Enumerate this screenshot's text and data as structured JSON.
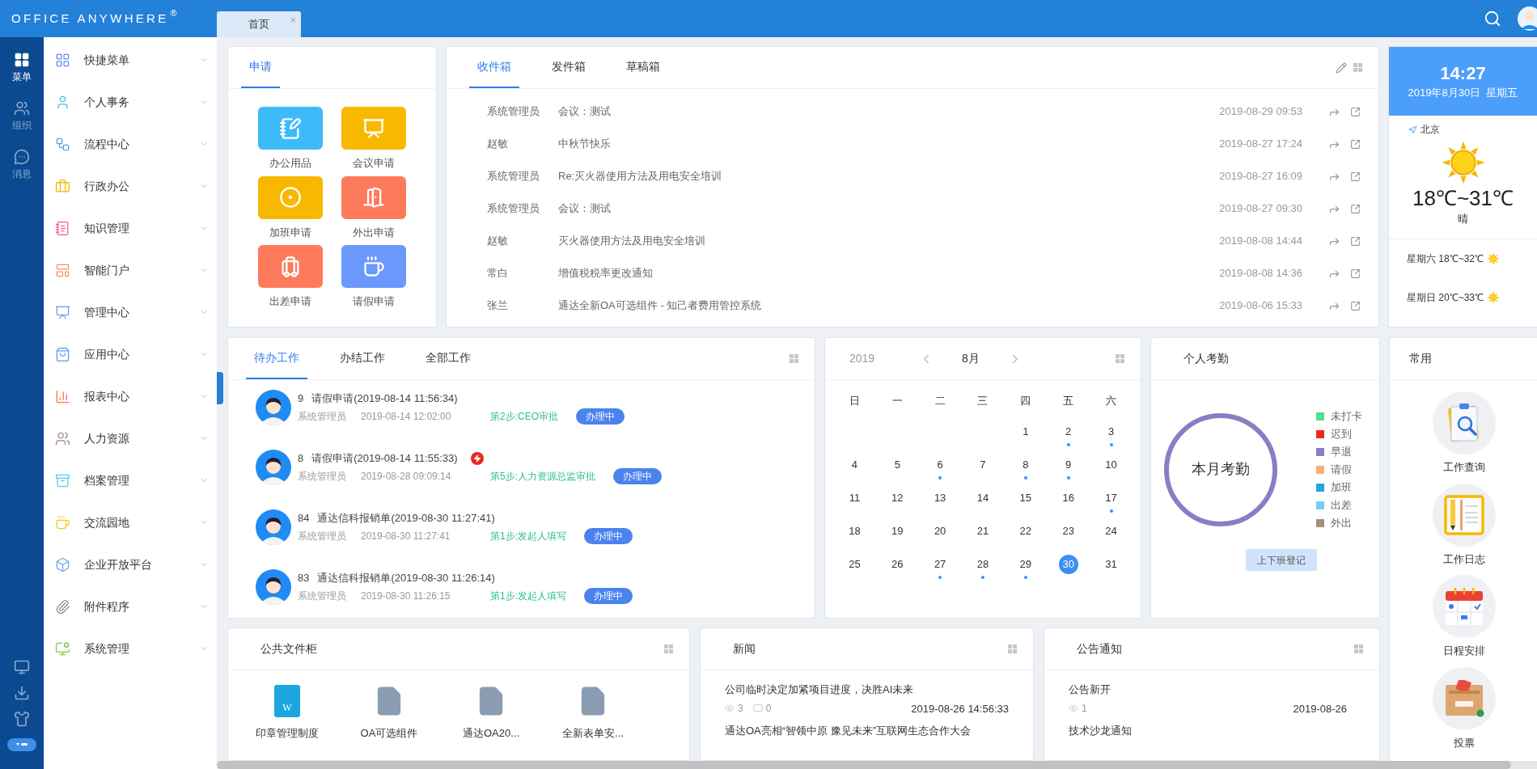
{
  "header": {
    "logo": "OFFICE ANYWHERE",
    "logo_mark": "®",
    "tabs": [
      {
        "label": "首页",
        "close": "×",
        "selected": true
      }
    ]
  },
  "rail": {
    "items": [
      {
        "label": "菜单",
        "selected": true
      },
      {
        "label": "组织",
        "selected": false
      },
      {
        "label": "消息",
        "selected": false
      }
    ]
  },
  "sidebar": {
    "items": [
      {
        "label": "快捷菜单"
      },
      {
        "label": "个人事务"
      },
      {
        "label": "流程中心"
      },
      {
        "label": "行政办公"
      },
      {
        "label": "知识管理"
      },
      {
        "label": "智能门户"
      },
      {
        "label": "管理中心"
      },
      {
        "label": "应用中心"
      },
      {
        "label": "报表中心"
      },
      {
        "label": "人力资源"
      },
      {
        "label": "档案管理"
      },
      {
        "label": "交流园地"
      },
      {
        "label": "企业开放平台"
      },
      {
        "label": "附件程序"
      },
      {
        "label": "系统管理"
      }
    ]
  },
  "apply": {
    "tabs": [
      {
        "label": "申请",
        "selected": true
      }
    ],
    "items": [
      {
        "label": "办公用品",
        "color": "#3dbbf8"
      },
      {
        "label": "会议申请",
        "color": "#f8b800"
      },
      {
        "label": "加班申请",
        "color": "#f8b800"
      },
      {
        "label": "外出申请",
        "color": "#fd7b5b"
      },
      {
        "label": "出差申请",
        "color": "#fd7b5b"
      },
      {
        "label": "请假申请",
        "color": "#6b98fb"
      }
    ]
  },
  "mail": {
    "tabs": [
      {
        "label": "收件箱",
        "selected": true
      },
      {
        "label": "发件箱",
        "selected": false
      },
      {
        "label": "草稿箱",
        "selected": false
      }
    ],
    "rows": [
      {
        "sender": "系统管理员",
        "subject": "会议：测试",
        "time": "2019-08-29 09:53"
      },
      {
        "sender": "赵敏",
        "subject": "中秋节快乐",
        "time": "2019-08-27 17:24"
      },
      {
        "sender": "系统管理员",
        "subject": "Re:灭火器使用方法及用电安全培训",
        "time": "2019-08-27 16:09"
      },
      {
        "sender": "系统管理员",
        "subject": "会议：测试",
        "time": "2019-08-27 09:30"
      },
      {
        "sender": "赵敏",
        "subject": "灭火器使用方法及用电安全培训",
        "time": "2019-08-08 14:44"
      },
      {
        "sender": "常白",
        "subject": "增值税税率更改通知",
        "time": "2019-08-08 14:36"
      },
      {
        "sender": "张兰",
        "subject": "通达全新OA可选组件 - 知己者费用管控系统",
        "time": "2019-08-06 15:33"
      }
    ]
  },
  "weather": {
    "time": "14:27",
    "date": "2019年8月30日  星期五",
    "city": "北京",
    "temp": "18℃~31℃",
    "condition": "晴",
    "forecast": [
      {
        "text": "星期六 18℃~32℃"
      },
      {
        "text": "星期日 20℃~33℃"
      }
    ]
  },
  "work": {
    "tabs": [
      {
        "label": "待办工作",
        "selected": true
      },
      {
        "label": "办结工作",
        "selected": false
      },
      {
        "label": "全部工作",
        "selected": false
      }
    ],
    "items": [
      {
        "number": "9",
        "title": "请假申请(2019-08-14 11:56:34)",
        "user": "系统管理员",
        "time": "2019-08-14 12:02:00",
        "step": "第2步:CEO审批",
        "status": "办理中",
        "urgent": false
      },
      {
        "number": "8",
        "title": "请假申请(2019-08-14 11:55:33)",
        "user": "系统管理员",
        "time": "2019-08-28 09:09:14",
        "step": "第5步:人力资源总监审批",
        "status": "办理中",
        "urgent": true
      },
      {
        "number": "84",
        "title": "通达信科报销单(2019-08-30 11:27:41)",
        "user": "系统管理员",
        "time": "2019-08-30 11:27:41",
        "step": "第1步:发起人填写",
        "status": "办理中",
        "urgent": false
      },
      {
        "number": "83",
        "title": "通达信科报销单(2019-08-30 11:26:14)",
        "user": "系统管理员",
        "time": "2019-08-30 11:26:15",
        "step": "第1步:发起人填写",
        "status": "办理中",
        "urgent": false
      }
    ]
  },
  "calendar": {
    "year": "2019",
    "month": "8月",
    "weekdays": [
      "日",
      "一",
      "二",
      "三",
      "四",
      "五",
      "六"
    ],
    "days": [
      {
        "kind": "blank"
      },
      {
        "kind": "blank"
      },
      {
        "kind": "blank"
      },
      {
        "kind": "blank"
      },
      {
        "kind": "day",
        "label": "1",
        "event": false,
        "selected": false
      },
      {
        "kind": "day",
        "label": "2",
        "event": true,
        "selected": false
      },
      {
        "kind": "day",
        "label": "3",
        "event": true,
        "selected": false
      },
      {
        "kind": "day",
        "label": "4",
        "event": false,
        "selected": false
      },
      {
        "kind": "day",
        "label": "5",
        "event": false,
        "selected": false
      },
      {
        "kind": "day",
        "label": "6",
        "event": true,
        "selected": false
      },
      {
        "kind": "day",
        "label": "7",
        "event": false,
        "selected": false
      },
      {
        "kind": "day",
        "label": "8",
        "event": true,
        "selected": false
      },
      {
        "kind": "day",
        "label": "9",
        "event": true,
        "selected": false
      },
      {
        "kind": "day",
        "label": "10",
        "event": false,
        "selected": false
      },
      {
        "kind": "day",
        "label": "11",
        "event": false,
        "selected": false
      },
      {
        "kind": "day",
        "label": "12",
        "event": false,
        "selected": false
      },
      {
        "kind": "day",
        "label": "13",
        "event": false,
        "selected": false
      },
      {
        "kind": "day",
        "label": "14",
        "event": false,
        "selected": false
      },
      {
        "kind": "day",
        "label": "15",
        "event": false,
        "selected": false
      },
      {
        "kind": "day",
        "label": "16",
        "event": false,
        "selected": false
      },
      {
        "kind": "day",
        "label": "17",
        "event": true,
        "selected": false
      },
      {
        "kind": "day",
        "label": "18",
        "event": false,
        "selected": false
      },
      {
        "kind": "day",
        "label": "19",
        "event": false,
        "selected": false
      },
      {
        "kind": "day",
        "label": "20",
        "event": false,
        "selected": false
      },
      {
        "kind": "day",
        "label": "21",
        "event": false,
        "selected": false
      },
      {
        "kind": "day",
        "label": "22",
        "event": false,
        "selected": false
      },
      {
        "kind": "day",
        "label": "23",
        "event": false,
        "selected": false
      },
      {
        "kind": "day",
        "label": "24",
        "event": false,
        "selected": false
      },
      {
        "kind": "day",
        "label": "25",
        "event": false,
        "selected": false
      },
      {
        "kind": "day",
        "label": "26",
        "event": false,
        "selected": false
      },
      {
        "kind": "day",
        "label": "27",
        "event": true,
        "selected": false
      },
      {
        "kind": "day",
        "label": "28",
        "event": true,
        "selected": false
      },
      {
        "kind": "day",
        "label": "29",
        "event": true,
        "selected": false
      },
      {
        "kind": "day",
        "label": "30",
        "event": false,
        "selected": true
      },
      {
        "kind": "day",
        "label": "31",
        "event": false,
        "selected": false
      }
    ]
  },
  "attendance": {
    "title": "个人考勤",
    "ring_label": "本月考勤",
    "legend": [
      {
        "label": "未打卡",
        "color": "#52de97"
      },
      {
        "label": "迟到",
        "color": "#e8291c"
      },
      {
        "label": "早退",
        "color": "#8e7cc3"
      },
      {
        "label": "请假",
        "color": "#f6b07b"
      },
      {
        "label": "加班",
        "color": "#20a7e0"
      },
      {
        "label": "出差",
        "color": "#78cdf4"
      },
      {
        "label": "外出",
        "color": "#a38f77"
      }
    ],
    "button": "上下班登记"
  },
  "common": {
    "title": "常用",
    "items": [
      {
        "label": "工作查询"
      },
      {
        "label": "工作日志"
      },
      {
        "label": "日程安排"
      },
      {
        "label": "投票"
      }
    ]
  },
  "files": {
    "title": "公共文件柜",
    "items": [
      {
        "name": "印章管理制度",
        "kind": "word",
        "badge": "W"
      },
      {
        "name": "OA可选组件",
        "kind": "file"
      },
      {
        "name": "通达OA20...",
        "kind": "file"
      },
      {
        "name": "全新表单安...",
        "kind": "file"
      }
    ]
  },
  "news": {
    "title": "新闻",
    "items": [
      {
        "title": "公司临时决定加紧项目进度，决胜AI未来",
        "views": "3",
        "comments": "0",
        "time": "2019-08-26 14:56:33"
      },
      {
        "title": "通达OA亮相“智领中原 豫见未来”互联网生态合作大会"
      }
    ]
  },
  "notices": {
    "title": "公告通知",
    "items": [
      {
        "title": "公告新开",
        "views": "1",
        "time": "2019-08-26"
      },
      {
        "title": "技术沙龙通知"
      }
    ]
  }
}
